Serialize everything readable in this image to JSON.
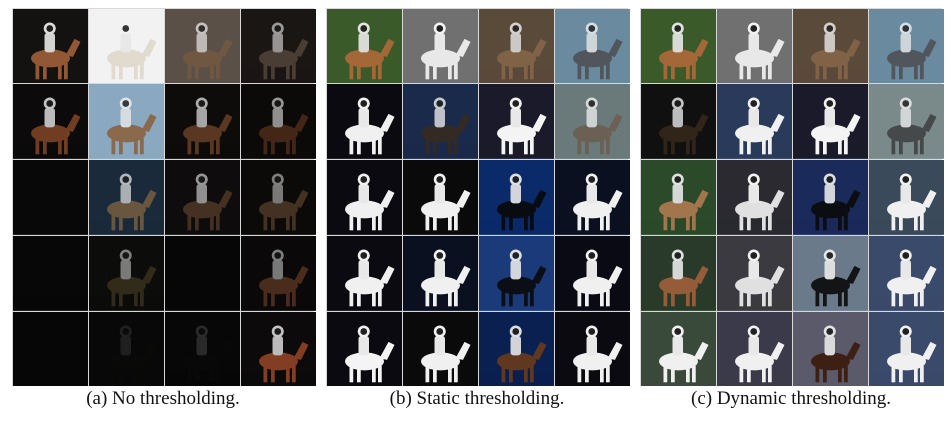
{
  "figure": {
    "panels": [
      {
        "caption": "(a) No thresholding.",
        "rows": [
          [
            {
              "bg": "#141210",
              "fg": "#a0603a",
              "l": 0.9
            },
            {
              "bg": "#f2f2f2",
              "fg": "#e0d8cc",
              "l": 0.9
            },
            {
              "bg": "#5a5048",
              "fg": "#7a5a40",
              "l": 0.7
            },
            {
              "bg": "#1a1614",
              "fg": "#6a5a4a",
              "l": 0.6
            }
          ],
          [
            {
              "bg": "#0c0a0a",
              "fg": "#8a4a2a",
              "l": 0.8
            },
            {
              "bg": "#8aa8c0",
              "fg": "#8a5a30",
              "l": 0.8
            },
            {
              "bg": "#0e0c0a",
              "fg": "#7a4a2a",
              "l": 0.7
            },
            {
              "bg": "#0c0a08",
              "fg": "#6a3a22",
              "l": 0.6
            }
          ],
          [
            {
              "bg": "#080808",
              "fg": "#101010",
              "l": 0.0
            },
            {
              "bg": "#1a2a3a",
              "fg": "#8a6a40",
              "l": 0.7
            },
            {
              "bg": "#0e0c0c",
              "fg": "#6a4a32",
              "l": 0.6
            },
            {
              "bg": "#0c0a08",
              "fg": "#7a5a3a",
              "l": 0.5
            }
          ],
          [
            {
              "bg": "#070707",
              "fg": "#0f0f0f",
              "l": 0.0
            },
            {
              "bg": "#0c0c0a",
              "fg": "#5a4a2a",
              "l": 0.5
            },
            {
              "bg": "#060606",
              "fg": "#0e0e0e",
              "l": 0.0
            },
            {
              "bg": "#0a0808",
              "fg": "#8a5030",
              "l": 0.5
            }
          ],
          [
            {
              "bg": "#060606",
              "fg": "#0c0c0c",
              "l": 0.0
            },
            {
              "bg": "#080808",
              "fg": "#141210",
              "l": 0.1
            },
            {
              "bg": "#070707",
              "fg": "#1a1412",
              "l": 0.15
            },
            {
              "bg": "#0c0a0a",
              "fg": "#a04a2a",
              "l": 0.8
            }
          ]
        ]
      },
      {
        "caption": "(b) Static thresholding.",
        "rows": [
          [
            {
              "bg": "#3a5a2a",
              "fg": "#b06a3a",
              "l": 0.9
            },
            {
              "bg": "#707070",
              "fg": "#e8e8e8",
              "l": 1.0
            },
            {
              "bg": "#5a4a3a",
              "fg": "#8a6a4a",
              "l": 0.8
            },
            {
              "bg": "#6a8aa0",
              "fg": "#4a4a4a",
              "l": 0.8
            }
          ],
          [
            {
              "bg": "#0a0a10",
              "fg": "#f0f0f0",
              "l": 1.0
            },
            {
              "bg": "#1a2a4a",
              "fg": "#3a2a1a",
              "l": 0.8
            },
            {
              "bg": "#1a1a2a",
              "fg": "#f4f4f4",
              "l": 1.0
            },
            {
              "bg": "#6a7a7a",
              "fg": "#6a5a4a",
              "l": 0.8
            }
          ],
          [
            {
              "bg": "#0a0a10",
              "fg": "#f0f0f0",
              "l": 1.0
            },
            {
              "bg": "#0a0a0a",
              "fg": "#f0f0f0",
              "l": 1.0
            },
            {
              "bg": "#0a2a6a",
              "fg": "#080808",
              "l": 0.9
            },
            {
              "bg": "#0a1020",
              "fg": "#f0f0f0",
              "l": 1.0
            }
          ],
          [
            {
              "bg": "#0a0a10",
              "fg": "#f0f0f0",
              "l": 1.0
            },
            {
              "bg": "#0a1020",
              "fg": "#f0f0f0",
              "l": 1.0
            },
            {
              "bg": "#1a3a7a",
              "fg": "#0a0a0a",
              "l": 0.9
            },
            {
              "bg": "#0a0a14",
              "fg": "#f0f0f0",
              "l": 1.0
            }
          ],
          [
            {
              "bg": "#0a0a10",
              "fg": "#f4f4f4",
              "l": 1.0
            },
            {
              "bg": "#0a0a0a",
              "fg": "#f0f0f0",
              "l": 1.0
            },
            {
              "bg": "#0a2050",
              "fg": "#6a3a1a",
              "l": 0.9
            },
            {
              "bg": "#0a0a10",
              "fg": "#f0f0f0",
              "l": 1.0
            }
          ]
        ]
      },
      {
        "caption": "(c) Dynamic thresholding.",
        "rows": [
          [
            {
              "bg": "#3a5a2a",
              "fg": "#b06a3a",
              "l": 0.9
            },
            {
              "bg": "#707070",
              "fg": "#e8e8e8",
              "l": 1.0
            },
            {
              "bg": "#5a4a3a",
              "fg": "#8a6a4a",
              "l": 0.8
            },
            {
              "bg": "#6a8aa0",
              "fg": "#4a4a4a",
              "l": 0.8
            }
          ],
          [
            {
              "bg": "#101010",
              "fg": "#3a2a1a",
              "l": 0.8
            },
            {
              "bg": "#2a3a5a",
              "fg": "#f0f0f0",
              "l": 1.0
            },
            {
              "bg": "#1a1a2a",
              "fg": "#f4f4f4",
              "l": 1.0
            },
            {
              "bg": "#7a8a8a",
              "fg": "#3a3a3a",
              "l": 0.8
            }
          ],
          [
            {
              "bg": "#2a4a2a",
              "fg": "#b07a50",
              "l": 0.9
            },
            {
              "bg": "#2a2a30",
              "fg": "#e0e0e0",
              "l": 1.0
            },
            {
              "bg": "#1a2a5a",
              "fg": "#0a0a0a",
              "l": 0.9
            },
            {
              "bg": "#3a4a5a",
              "fg": "#f0f0f0",
              "l": 1.0
            }
          ],
          [
            {
              "bg": "#2a3a2a",
              "fg": "#a0603a",
              "l": 0.9
            },
            {
              "bg": "#3a3a40",
              "fg": "#e0e0e0",
              "l": 1.0
            },
            {
              "bg": "#6a7a8a",
              "fg": "#0a0a0a",
              "l": 0.9
            },
            {
              "bg": "#3a4a6a",
              "fg": "#f0f0f0",
              "l": 1.0
            }
          ],
          [
            {
              "bg": "#3a4a3a",
              "fg": "#f0f0f0",
              "l": 1.0
            },
            {
              "bg": "#3a3a4a",
              "fg": "#f0f0f0",
              "l": 1.0
            },
            {
              "bg": "#5a5a6a",
              "fg": "#3a1a0a",
              "l": 0.9
            },
            {
              "bg": "#3a4a6a",
              "fg": "#f0f0f0",
              "l": 1.0
            }
          ]
        ]
      }
    ]
  }
}
